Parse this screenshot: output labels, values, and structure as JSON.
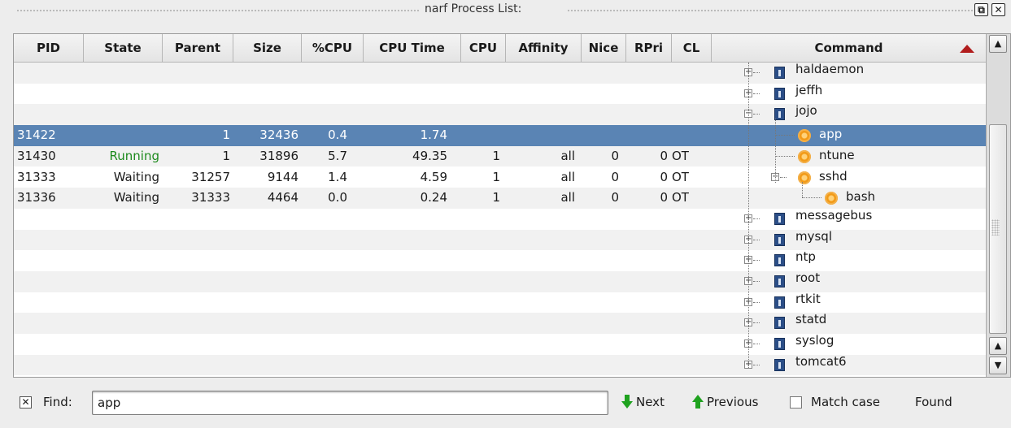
{
  "window": {
    "title": "narf Process List:"
  },
  "colors": {
    "running": "#1d8a1d",
    "selection": "#5a84b4",
    "sort_arrow": "#b11d1d"
  },
  "table": {
    "columns": [
      "PID",
      "State",
      "Parent",
      "Size",
      "%CPU",
      "CPU Time",
      "CPU",
      "Affinity",
      "Nice",
      "RPri",
      "CL",
      "Command"
    ],
    "sort_column": "Command",
    "rows": [
      {
        "pid": "",
        "state": "",
        "parent": "",
        "size": "",
        "cpu_pct": "",
        "cpu_time": "",
        "cpu": "",
        "affinity": "",
        "nice": "",
        "rpri": "",
        "cl": "",
        "command": "haldaemon",
        "kind": "user",
        "expander": "+",
        "level": 0
      },
      {
        "pid": "",
        "state": "",
        "parent": "",
        "size": "",
        "cpu_pct": "",
        "cpu_time": "",
        "cpu": "",
        "affinity": "",
        "nice": "",
        "rpri": "",
        "cl": "",
        "command": "jeffh",
        "kind": "user",
        "expander": "+",
        "level": 0
      },
      {
        "pid": "",
        "state": "",
        "parent": "",
        "size": "",
        "cpu_pct": "",
        "cpu_time": "",
        "cpu": "",
        "affinity": "",
        "nice": "",
        "rpri": "",
        "cl": "",
        "command": "jojo",
        "kind": "user",
        "expander": "-",
        "level": 0
      },
      {
        "pid": "31422",
        "state": "",
        "parent": "1",
        "size": "32436",
        "cpu_pct": "0.4",
        "cpu_time": "1.74",
        "cpu": "",
        "affinity": "",
        "nice": "",
        "rpri": "",
        "cl": "",
        "command": "app",
        "kind": "process",
        "expander": "",
        "level": 1,
        "selected": true
      },
      {
        "pid": "31430",
        "state": "Running",
        "parent": "1",
        "size": "31896",
        "cpu_pct": "5.7",
        "cpu_time": "49.35",
        "cpu": "1",
        "affinity": "all",
        "nice": "0",
        "rpri": "0",
        "cl": "OT",
        "command": "ntune",
        "kind": "process",
        "expander": "",
        "level": 1
      },
      {
        "pid": "31333",
        "state": "Waiting",
        "parent": "31257",
        "size": "9144",
        "cpu_pct": "1.4",
        "cpu_time": "4.59",
        "cpu": "1",
        "affinity": "all",
        "nice": "0",
        "rpri": "0",
        "cl": "OT",
        "command": "sshd",
        "kind": "process",
        "expander": "-",
        "level": 1
      },
      {
        "pid": "31336",
        "state": "Waiting",
        "parent": "31333",
        "size": "4464",
        "cpu_pct": "0.0",
        "cpu_time": "0.24",
        "cpu": "1",
        "affinity": "all",
        "nice": "0",
        "rpri": "0",
        "cl": "OT",
        "command": "bash",
        "kind": "process",
        "expander": "",
        "level": 2
      },
      {
        "pid": "",
        "state": "",
        "parent": "",
        "size": "",
        "cpu_pct": "",
        "cpu_time": "",
        "cpu": "",
        "affinity": "",
        "nice": "",
        "rpri": "",
        "cl": "",
        "command": "messagebus",
        "kind": "user",
        "expander": "+",
        "level": 0
      },
      {
        "pid": "",
        "state": "",
        "parent": "",
        "size": "",
        "cpu_pct": "",
        "cpu_time": "",
        "cpu": "",
        "affinity": "",
        "nice": "",
        "rpri": "",
        "cl": "",
        "command": "mysql",
        "kind": "user",
        "expander": "+",
        "level": 0
      },
      {
        "pid": "",
        "state": "",
        "parent": "",
        "size": "",
        "cpu_pct": "",
        "cpu_time": "",
        "cpu": "",
        "affinity": "",
        "nice": "",
        "rpri": "",
        "cl": "",
        "command": "ntp",
        "kind": "user",
        "expander": "+",
        "level": 0
      },
      {
        "pid": "",
        "state": "",
        "parent": "",
        "size": "",
        "cpu_pct": "",
        "cpu_time": "",
        "cpu": "",
        "affinity": "",
        "nice": "",
        "rpri": "",
        "cl": "",
        "command": "root",
        "kind": "user",
        "expander": "+",
        "level": 0
      },
      {
        "pid": "",
        "state": "",
        "parent": "",
        "size": "",
        "cpu_pct": "",
        "cpu_time": "",
        "cpu": "",
        "affinity": "",
        "nice": "",
        "rpri": "",
        "cl": "",
        "command": "rtkit",
        "kind": "user",
        "expander": "+",
        "level": 0
      },
      {
        "pid": "",
        "state": "",
        "parent": "",
        "size": "",
        "cpu_pct": "",
        "cpu_time": "",
        "cpu": "",
        "affinity": "",
        "nice": "",
        "rpri": "",
        "cl": "",
        "command": "statd",
        "kind": "user",
        "expander": "+",
        "level": 0
      },
      {
        "pid": "",
        "state": "",
        "parent": "",
        "size": "",
        "cpu_pct": "",
        "cpu_time": "",
        "cpu": "",
        "affinity": "",
        "nice": "",
        "rpri": "",
        "cl": "",
        "command": "syslog",
        "kind": "user",
        "expander": "+",
        "level": 0
      },
      {
        "pid": "",
        "state": "",
        "parent": "",
        "size": "",
        "cpu_pct": "",
        "cpu_time": "",
        "cpu": "",
        "affinity": "",
        "nice": "",
        "rpri": "",
        "cl": "",
        "command": "tomcat6",
        "kind": "user",
        "expander": "+",
        "level": 0
      }
    ]
  },
  "find": {
    "label": "Find:",
    "value": "app",
    "next_label": "Next",
    "previous_label": "Previous",
    "match_case_label": "Match case",
    "status": "Found"
  },
  "icons": {
    "close_find": "close-icon",
    "float": "float-icon",
    "close_window": "close-icon",
    "next": "arrow-down-icon",
    "previous": "arrow-up-icon",
    "user": "user-icon",
    "process": "process-icon"
  }
}
